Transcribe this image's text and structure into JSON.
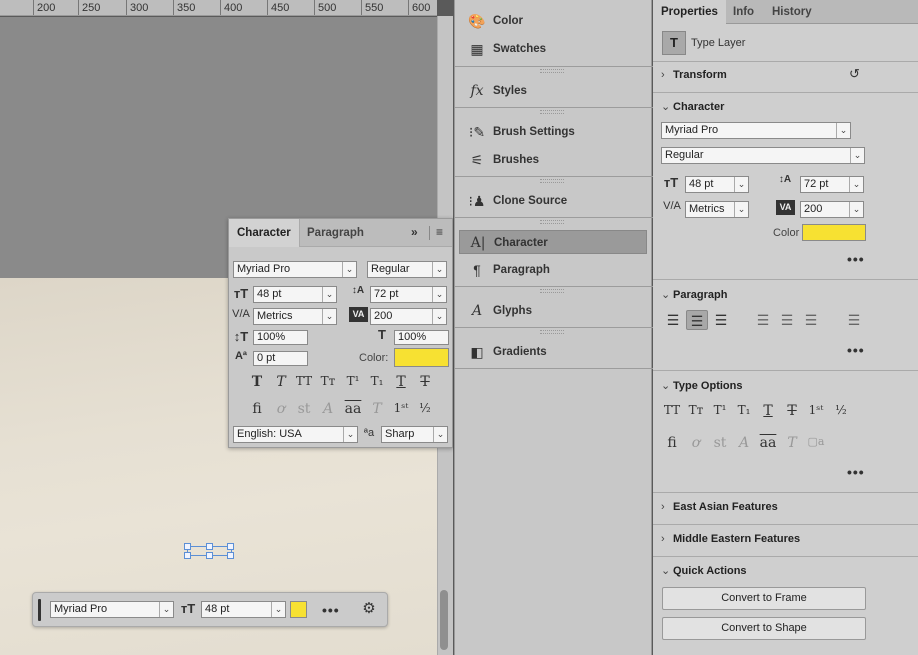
{
  "ruler": {
    "ticks": [
      "200",
      "250",
      "300",
      "350",
      "400",
      "450",
      "500",
      "550",
      "600"
    ]
  },
  "character_panel": {
    "tabs": [
      "Character",
      "Paragraph"
    ],
    "font_family": "Myriad Pro",
    "font_style": "Regular",
    "font_size": "48 pt",
    "leading": "72 pt",
    "kerning": "Metrics",
    "tracking": "200",
    "vertical_scale": "100%",
    "horizontal_scale": "100%",
    "baseline_shift": "0 pt",
    "color_label": "Color:",
    "language": "English: USA",
    "antialias": "Sharp",
    "color": "#f7e132"
  },
  "dock": {
    "items": [
      "Color",
      "Swatches",
      "Styles",
      "Brush Settings",
      "Brushes",
      "Clone Source",
      "Character",
      "Paragraph",
      "Glyphs",
      "Gradients"
    ]
  },
  "properties": {
    "tabs": [
      "Properties",
      "Info",
      "History"
    ],
    "layer_type": "Type Layer",
    "sections": {
      "transform": "Transform",
      "character": "Character",
      "paragraph": "Paragraph",
      "type_options": "Type Options",
      "east_asian": "East Asian Features",
      "middle_eastern": "Middle Eastern Features",
      "quick_actions": "Quick Actions"
    },
    "font_family": "Myriad Pro",
    "font_style": "Regular",
    "font_size": "48 pt",
    "leading": "72 pt",
    "kerning": "Metrics",
    "tracking": "200",
    "color_label": "Color",
    "more": "•••",
    "buttons": {
      "convert_frame": "Convert to Frame",
      "convert_shape": "Convert to Shape"
    }
  },
  "context_bar": {
    "font_family": "Myriad Pro",
    "font_size": "48 pt",
    "more": "•••"
  }
}
